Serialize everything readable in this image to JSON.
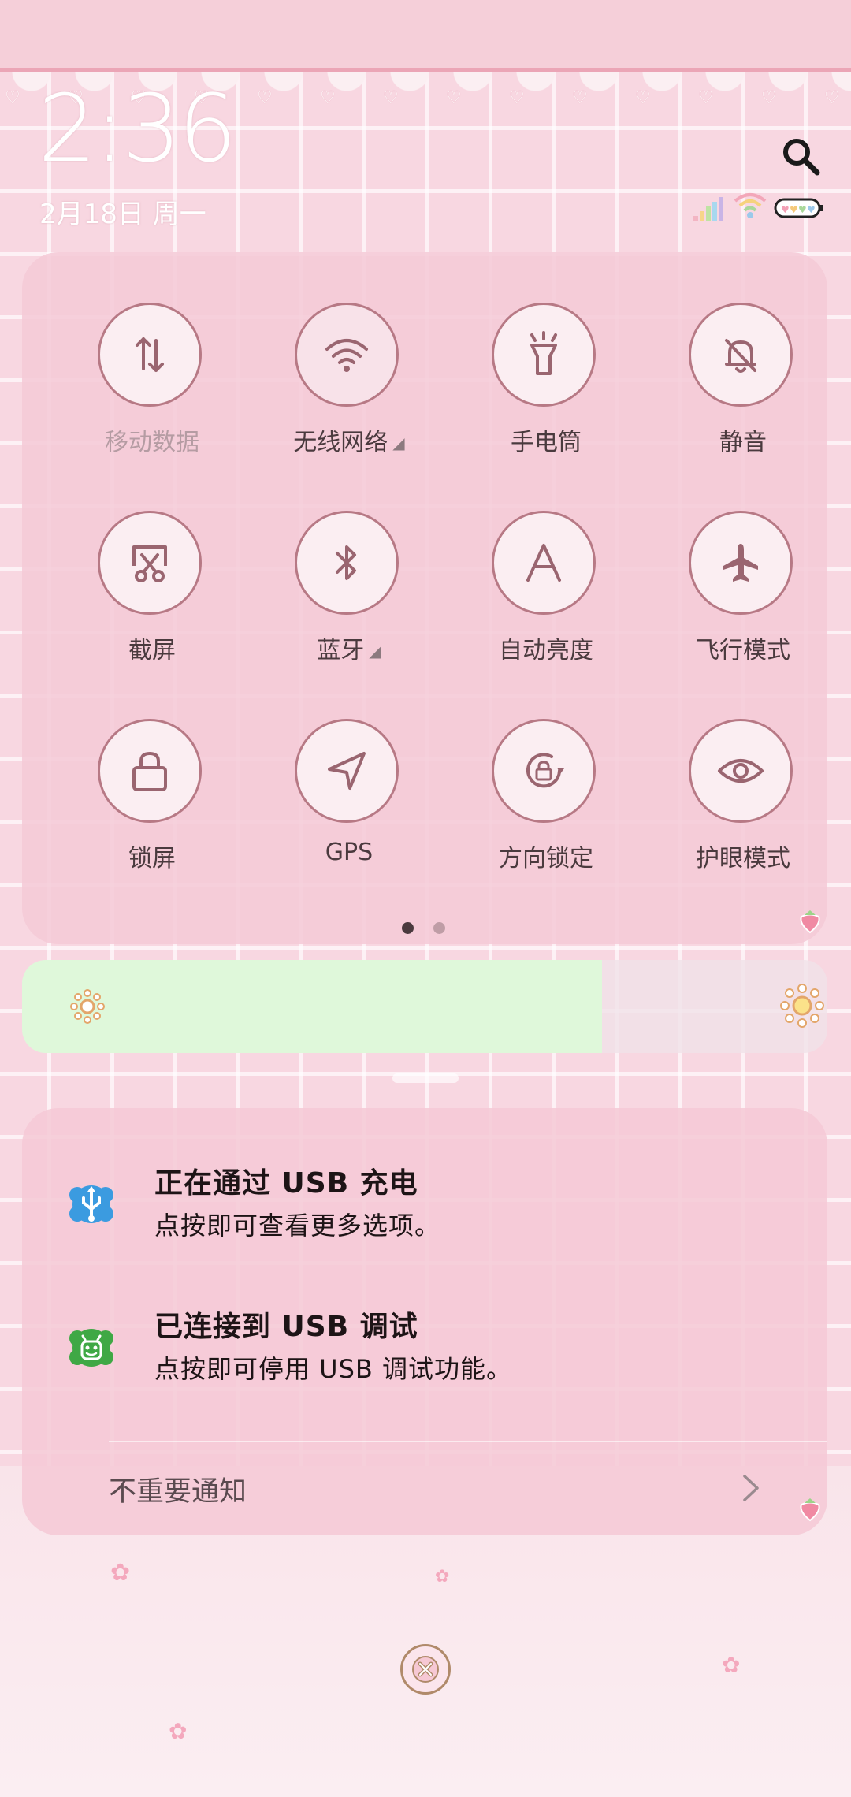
{
  "status": {
    "time": "2:36",
    "date": "2月18日 周一"
  },
  "quick_settings": {
    "tiles": [
      {
        "label": "移动数据",
        "icon": "mobile-data-icon",
        "enabled": false
      },
      {
        "label": "无线网络",
        "icon": "wifi-icon",
        "enabled": true,
        "expandable": true
      },
      {
        "label": "手电筒",
        "icon": "flashlight-icon",
        "enabled": false
      },
      {
        "label": "静音",
        "icon": "bell-off-icon",
        "enabled": false
      },
      {
        "label": "截屏",
        "icon": "screenshot-icon",
        "enabled": false
      },
      {
        "label": "蓝牙",
        "icon": "bluetooth-icon",
        "enabled": false,
        "expandable": true
      },
      {
        "label": "自动亮度",
        "icon": "auto-brightness-icon",
        "enabled": false
      },
      {
        "label": "飞行模式",
        "icon": "airplane-icon",
        "enabled": false
      },
      {
        "label": "锁屏",
        "icon": "lock-icon",
        "enabled": false
      },
      {
        "label": "GPS",
        "icon": "location-arrow-icon",
        "enabled": false
      },
      {
        "label": "方向锁定",
        "icon": "rotation-lock-icon",
        "enabled": false
      },
      {
        "label": "护眼模式",
        "icon": "eye-icon",
        "enabled": false
      }
    ],
    "page": {
      "current": 1,
      "total": 2
    }
  },
  "brightness": {
    "level": 0.72
  },
  "notifications": [
    {
      "title": "正在通过 USB 充电",
      "text": "点按即可查看更多选项。",
      "icon": "usb-icon"
    },
    {
      "title": "已连接到 USB 调试",
      "text": "点按即可停用 USB 调试功能。",
      "icon": "android-debug-icon"
    }
  ],
  "minor_notifications": {
    "label": "不重要通知"
  },
  "colors": {
    "accent": "#b77985",
    "panel": "#f5c9d6",
    "brightness_fill": "#dff8da"
  }
}
